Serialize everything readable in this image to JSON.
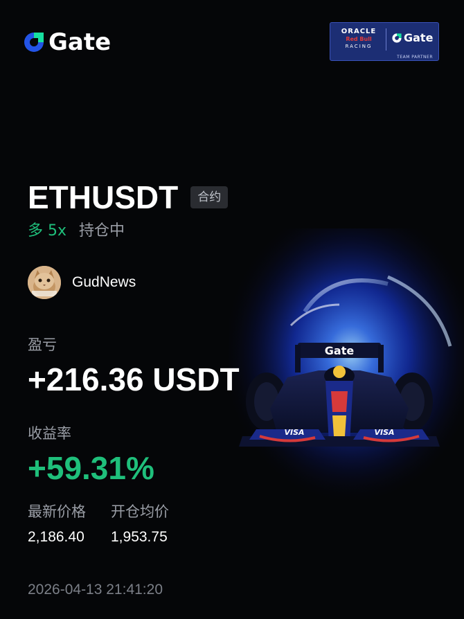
{
  "brand": {
    "name": "Gate"
  },
  "partner_badge": {
    "line1": "ORACLE",
    "line2": "Red Bull",
    "line3": "RACING",
    "gate": "Gate",
    "sub": "TEAM PARTNER"
  },
  "position": {
    "pair": "ETHUSDT",
    "contract_badge": "合约",
    "side": "多 5x",
    "status": "持仓中"
  },
  "user": {
    "name": "GudNews"
  },
  "pnl": {
    "label": "盈亏",
    "value": "+216.36 USDT"
  },
  "roi": {
    "label": "收益率",
    "value": "+59.31%"
  },
  "prices": {
    "last_label": "最新价格",
    "last_value": "2,186.40",
    "entry_label": "开仓均价",
    "entry_value": "1,953.75"
  },
  "timestamp": "2026-04-13 21:41:20",
  "colors": {
    "background": "#050608",
    "positive": "#1fbf7b",
    "muted": "#9a9ea6",
    "brand_blue": "#2354e6"
  },
  "art": {
    "car_wing_text": "Gate",
    "car_side_text": "VISA"
  }
}
